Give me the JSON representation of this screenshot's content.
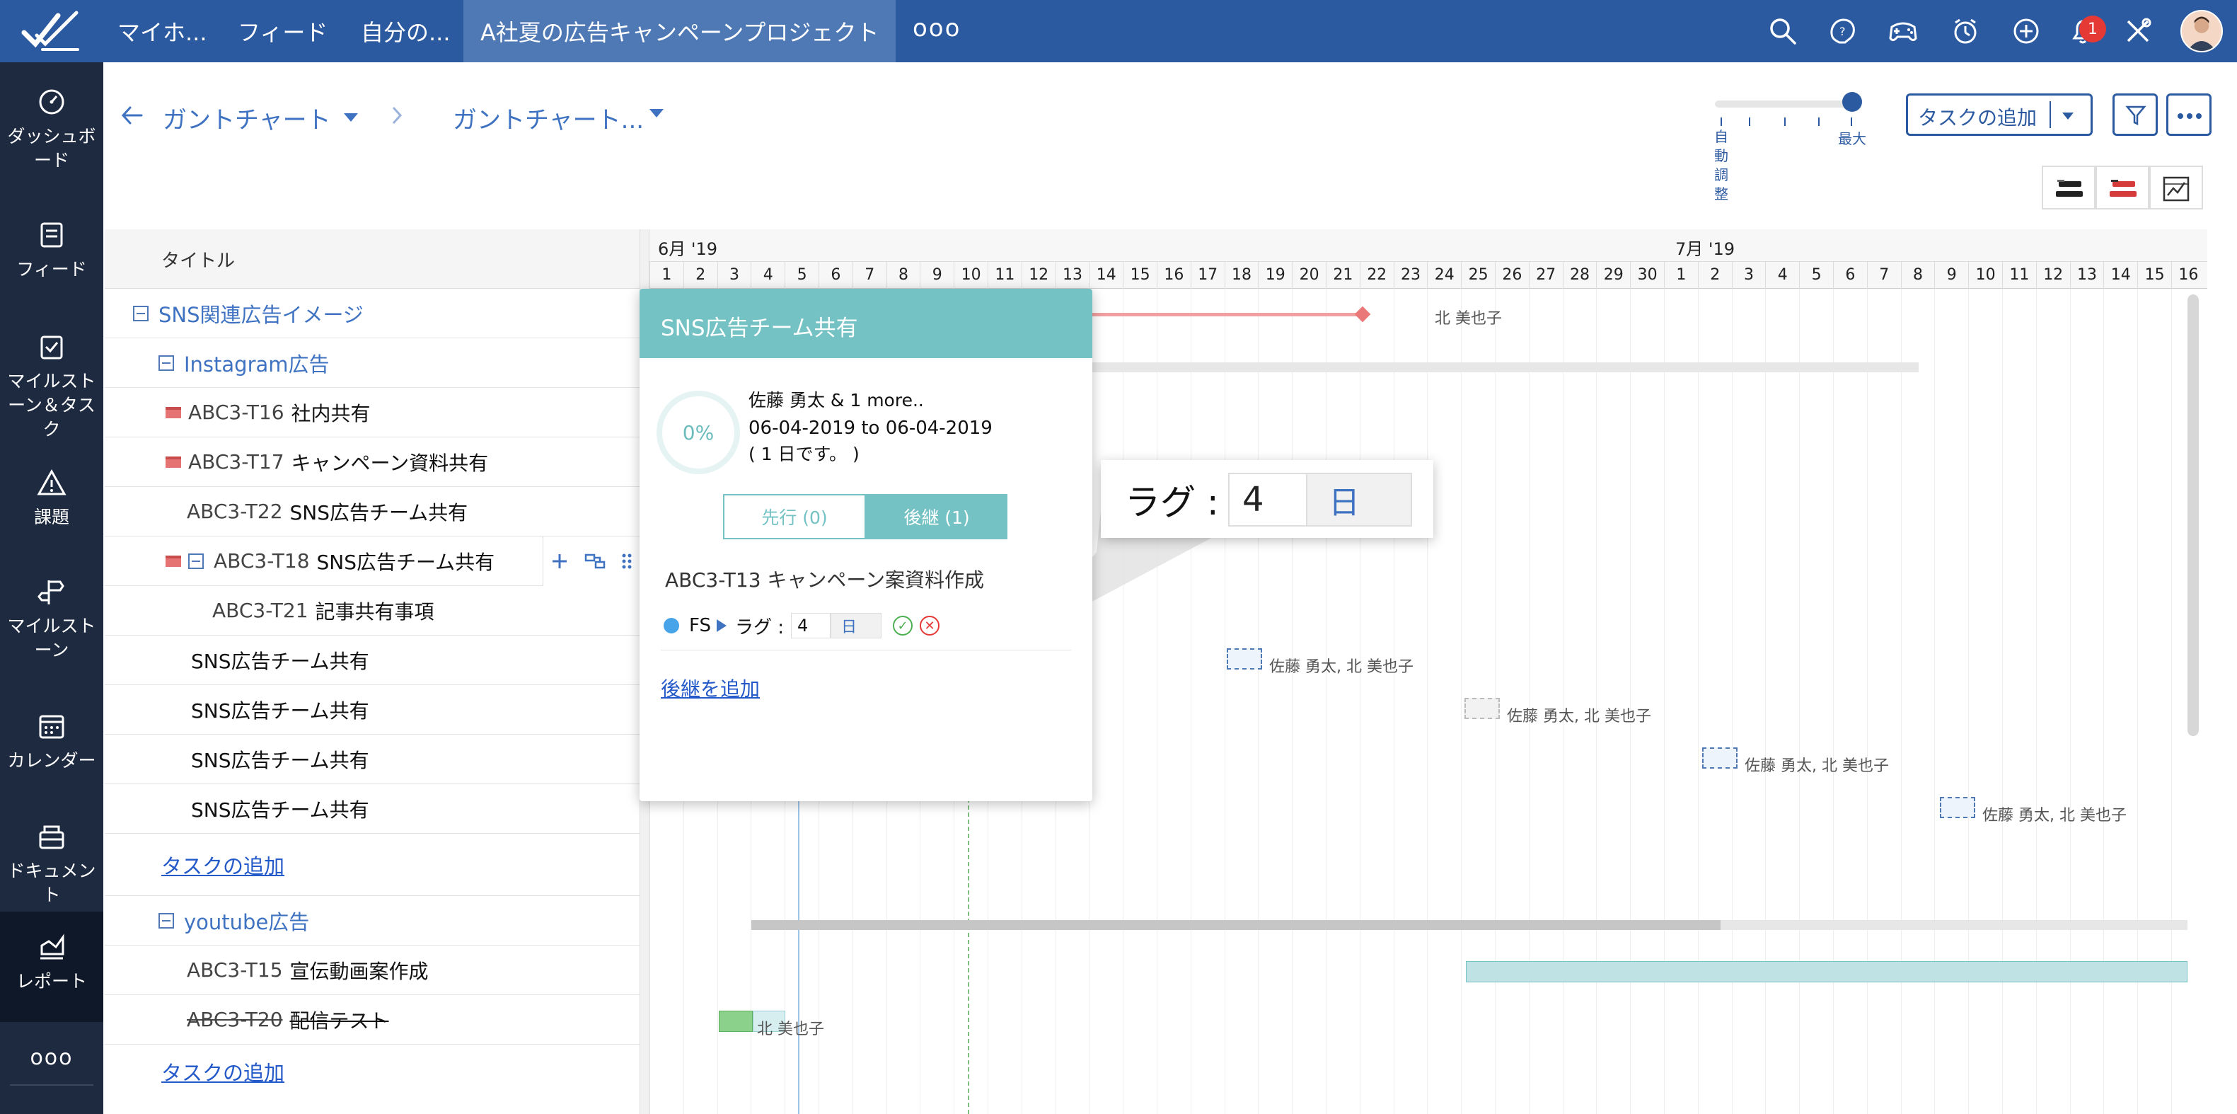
{
  "topbar": {
    "nav": [
      "マイホ...",
      "フィード",
      "自分の...",
      "A社夏の広告キャンペーンプロジェクト"
    ],
    "more": "ooo",
    "notification_count": "1",
    "accent": "#2c5aa0"
  },
  "sidebar": {
    "items": [
      {
        "label": "ダッシュボード",
        "icon": "dashboard-icon"
      },
      {
        "label": "フィード",
        "icon": "feed-icon"
      },
      {
        "label": "マイルストーン＆タスク",
        "icon": "milestone-task-icon"
      },
      {
        "label": "課題",
        "icon": "issue-icon"
      },
      {
        "label": "マイルストーン",
        "icon": "milestone-icon"
      },
      {
        "label": "カレンダー",
        "icon": "calendar-icon"
      },
      {
        "label": "ドキュメント",
        "icon": "document-icon"
      },
      {
        "label": "レポート",
        "icon": "report-icon"
      }
    ],
    "more": "ooo"
  },
  "header": {
    "breadcrumb1": "ガントチャート",
    "breadcrumb2": "ガントチャート...",
    "add_task": "タスクの追加",
    "zoom_auto": "自動調整",
    "zoom_max": "最大"
  },
  "list": {
    "column_title": "タイトル",
    "rows": [
      {
        "id": "",
        "name": "SNS関連広告イメージ"
      },
      {
        "id": "",
        "name": "Instagram広告"
      },
      {
        "id": "ABC3-T16",
        "name": "社内共有"
      },
      {
        "id": "ABC3-T17",
        "name": "キャンペーン資料共有"
      },
      {
        "id": "ABC3-T22",
        "name": "SNS広告チーム共有"
      },
      {
        "id": "ABC3-T18",
        "name": "SNS広告チーム共有"
      },
      {
        "id": "ABC3-T21",
        "name": "記事共有事項"
      },
      {
        "id": "",
        "name": "SNS広告チーム共有"
      },
      {
        "id": "",
        "name": "SNS広告チーム共有"
      },
      {
        "id": "",
        "name": "SNS広告チーム共有"
      },
      {
        "id": "",
        "name": "SNS広告チーム共有"
      },
      {
        "id": "",
        "name": "タスクの追加"
      },
      {
        "id": "",
        "name": "youtube広告"
      },
      {
        "id": "ABC3-T15",
        "name": "宣伝動画案作成"
      },
      {
        "id": "ABC3-T20",
        "name": "配信テスト"
      },
      {
        "id": "",
        "name": "タスクの追加"
      }
    ]
  },
  "gantt": {
    "month1": "6月 '19",
    "month2": "7月 '19",
    "june_days": [
      "1",
      "2",
      "3",
      "4",
      "5",
      "6",
      "7",
      "8",
      "9",
      "10",
      "11",
      "12",
      "13",
      "14",
      "15",
      "16",
      "17",
      "18",
      "19",
      "20",
      "21",
      "22",
      "23",
      "24",
      "25",
      "26",
      "27",
      "28",
      "29",
      "30"
    ],
    "july_days": [
      "1",
      "2",
      "3",
      "4",
      "5",
      "6",
      "7",
      "8",
      "9",
      "10",
      "11",
      "12",
      "13",
      "14",
      "15",
      "16"
    ],
    "labels": {
      "l1": "北 美也子",
      "l2": "佐藤 勇太, 北 美也子",
      "l3": "佐藤 勇太, 北 美也子",
      "l4": "佐藤 勇太, 北 美也子",
      "l5": "佐藤 勇太, 北 美也子",
      "l6": "北 美也子"
    }
  },
  "popup": {
    "title": "SNS広告チーム共有",
    "progress": "0%",
    "owners": "佐藤 勇太 & 1 more..",
    "dates": "06-04-2019 to 06-04-2019",
    "duration": "( 1 日です。 )",
    "tab_predecessor": "先行  (0)",
    "tab_successor": "後継  (1)",
    "successor_task": "ABC3-T13 キャンペーン案資料作成",
    "dep_type": "FS",
    "lag_label": "ラグ :",
    "lag_value": "4",
    "lag_unit": "日",
    "add_successor": "後継を追加"
  },
  "callout": {
    "label": "ラグ :",
    "value": "4",
    "unit": "日"
  }
}
